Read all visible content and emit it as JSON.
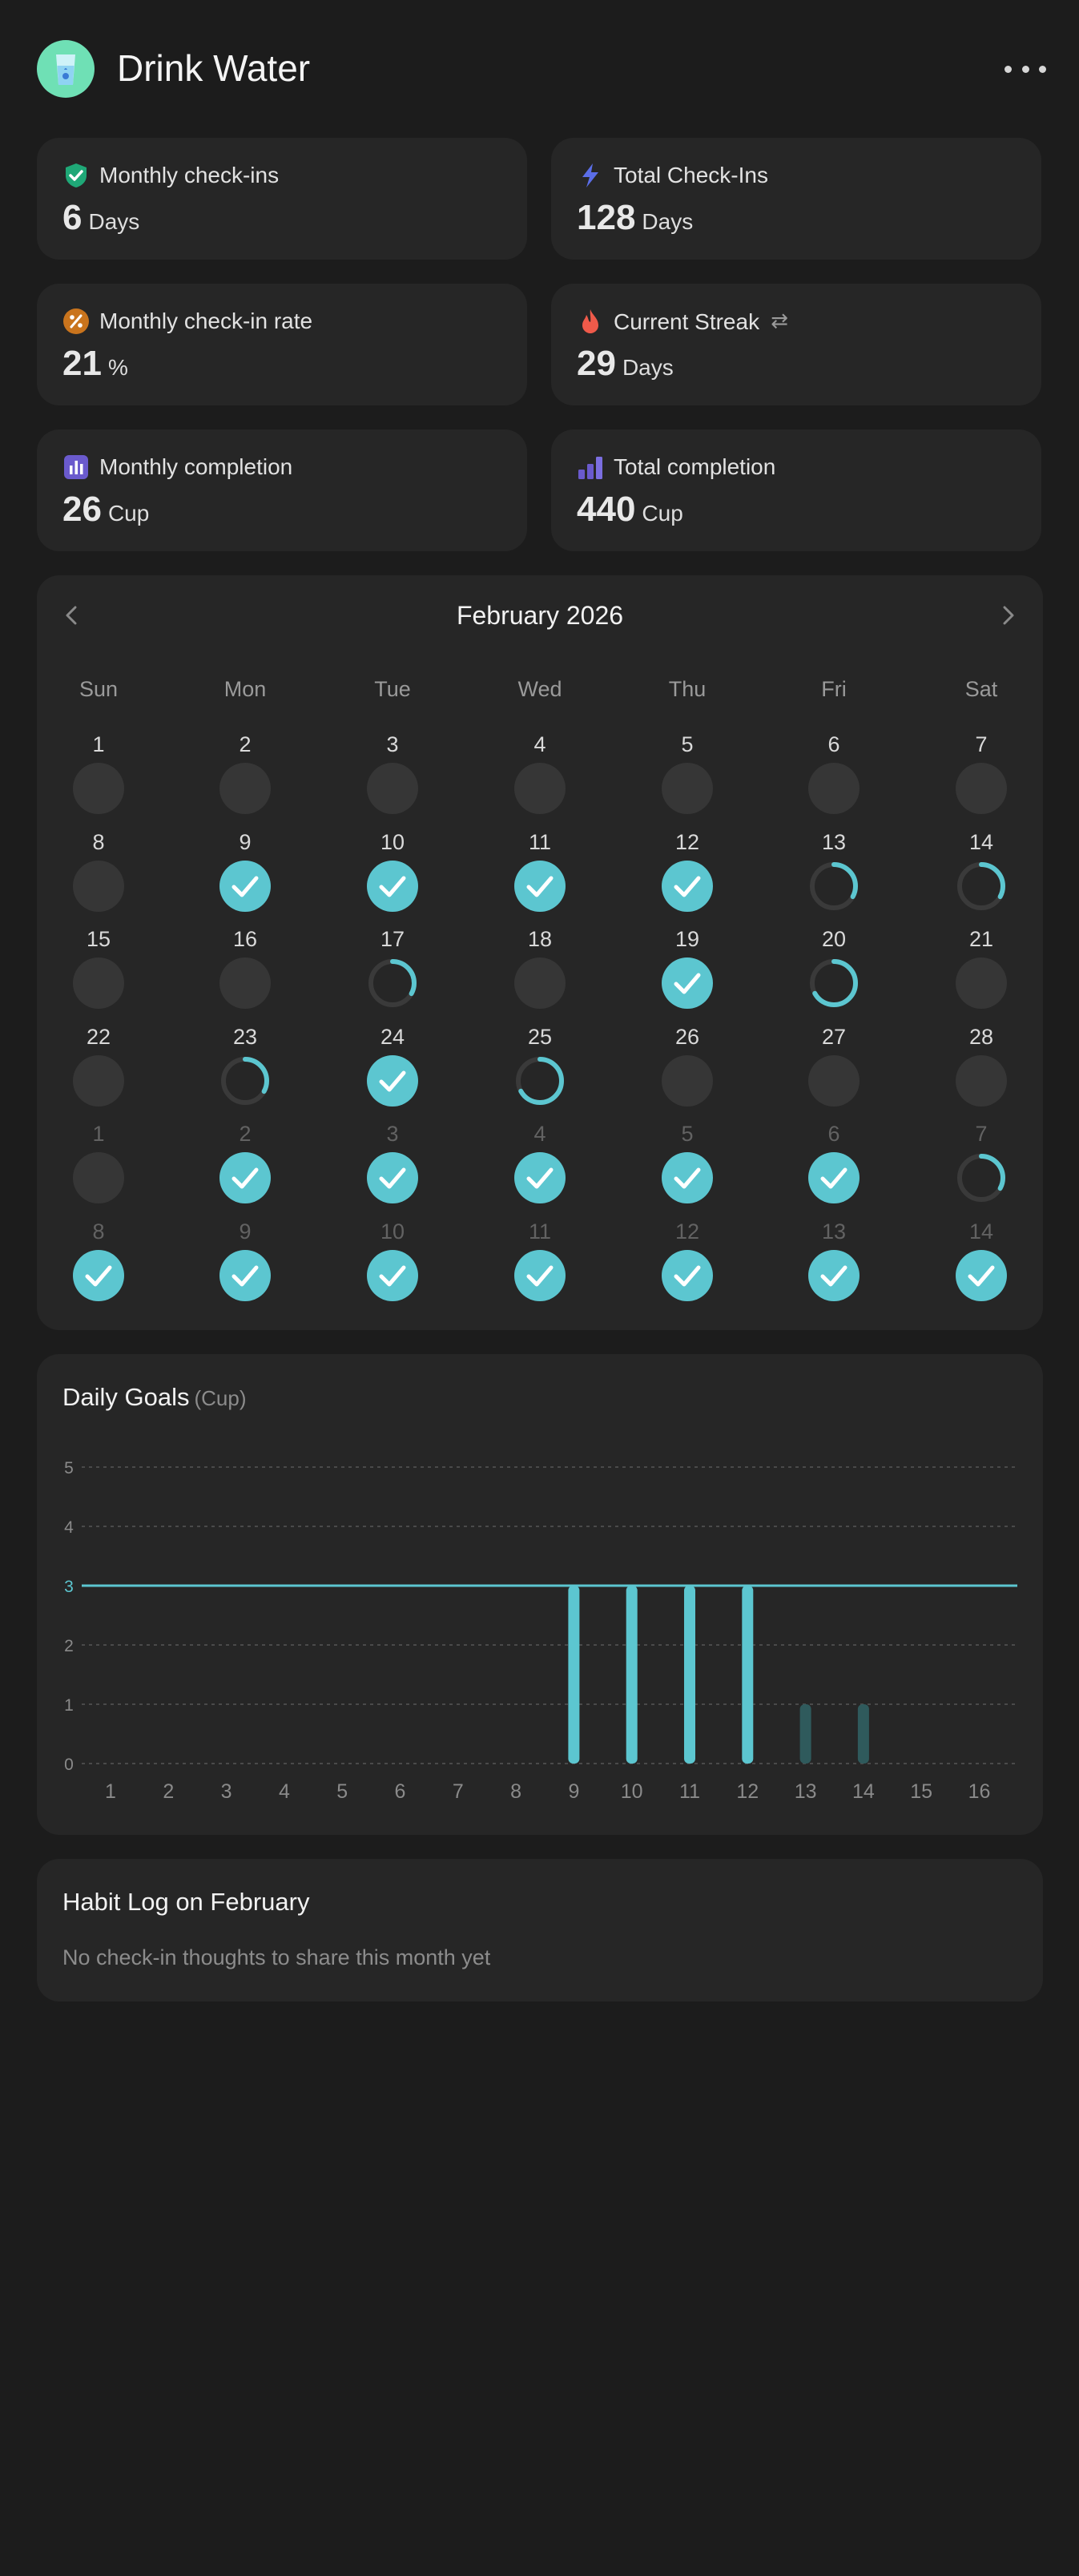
{
  "app": {
    "title": "Drink Water"
  },
  "stats": [
    {
      "label": "Monthly check-ins",
      "value": "6",
      "unit": "Days",
      "icon": "check-shield-icon",
      "color": "#1fa877"
    },
    {
      "label": "Total Check-Ins",
      "value": "128",
      "unit": "Days",
      "icon": "lightning-icon",
      "color": "#5b6ee8"
    },
    {
      "label": "Monthly check-in rate",
      "value": "21",
      "unit": "%",
      "icon": "percent-icon",
      "color": "#c9741d"
    },
    {
      "label": "Current Streak",
      "value": "29",
      "unit": "Days",
      "icon": "flame-icon",
      "color": "#ef5a4a"
    },
    {
      "label": "Monthly completion",
      "value": "26",
      "unit": "Cup",
      "icon": "bar-chart-icon",
      "color": "#6a5acd"
    },
    {
      "label": "Total completion",
      "value": "440",
      "unit": "Cup",
      "icon": "stacked-bars-icon",
      "color": "#6a5acd"
    }
  ],
  "calendar": {
    "title": "February 2026",
    "weekdays": [
      "Sun",
      "Mon",
      "Tue",
      "Wed",
      "Thu",
      "Fri",
      "Sat"
    ],
    "accent": "#5cc6d0",
    "weeks": [
      [
        {
          "d": "1",
          "p": 0
        },
        {
          "d": "2",
          "p": 0
        },
        {
          "d": "3",
          "p": 0
        },
        {
          "d": "4",
          "p": 0
        },
        {
          "d": "5",
          "p": 0
        },
        {
          "d": "6",
          "p": 0
        },
        {
          "d": "7",
          "p": 0
        }
      ],
      [
        {
          "d": "8",
          "p": 0
        },
        {
          "d": "9",
          "p": 1
        },
        {
          "d": "10",
          "p": 1
        },
        {
          "d": "11",
          "p": 1
        },
        {
          "d": "12",
          "p": 1
        },
        {
          "d": "13",
          "p": 0.33
        },
        {
          "d": "14",
          "p": 0.33
        }
      ],
      [
        {
          "d": "15",
          "p": 0
        },
        {
          "d": "16",
          "p": 0
        },
        {
          "d": "17",
          "p": 0.33
        },
        {
          "d": "18",
          "p": 0
        },
        {
          "d": "19",
          "p": 1
        },
        {
          "d": "20",
          "p": 0.67
        },
        {
          "d": "21",
          "p": 0
        }
      ],
      [
        {
          "d": "22",
          "p": 0
        },
        {
          "d": "23",
          "p": 0.33
        },
        {
          "d": "24",
          "p": 1
        },
        {
          "d": "25",
          "p": 0.67
        },
        {
          "d": "26",
          "p": 0
        },
        {
          "d": "27",
          "p": 0
        },
        {
          "d": "28",
          "p": 0
        }
      ],
      [
        {
          "d": "1",
          "p": 0,
          "other": true
        },
        {
          "d": "2",
          "p": 1,
          "other": true
        },
        {
          "d": "3",
          "p": 1,
          "other": true
        },
        {
          "d": "4",
          "p": 1,
          "other": true
        },
        {
          "d": "5",
          "p": 1,
          "other": true
        },
        {
          "d": "6",
          "p": 1,
          "other": true
        },
        {
          "d": "7",
          "p": 0.33,
          "other": true
        }
      ],
      [
        {
          "d": "8",
          "p": 1,
          "other": true
        },
        {
          "d": "9",
          "p": 1,
          "other": true
        },
        {
          "d": "10",
          "p": 1,
          "other": true
        },
        {
          "d": "11",
          "p": 1,
          "other": true
        },
        {
          "d": "12",
          "p": 1,
          "other": true
        },
        {
          "d": "13",
          "p": 1,
          "other": true
        },
        {
          "d": "14",
          "p": 1,
          "other": true
        }
      ]
    ]
  },
  "daily_goals": {
    "title": "Daily Goals",
    "unit": "(Cup)",
    "chart_data": {
      "type": "bar",
      "categories": [
        "1",
        "2",
        "3",
        "4",
        "5",
        "6",
        "7",
        "8",
        "9",
        "10",
        "11",
        "12",
        "13",
        "14",
        "15",
        "16"
      ],
      "values": [
        0,
        0,
        0,
        0,
        0,
        0,
        0,
        0,
        3,
        3,
        3,
        3,
        1,
        1,
        0,
        0
      ],
      "goal": 3,
      "ylim": [
        0,
        5
      ],
      "yticks": [
        "0",
        "1",
        "2",
        "3",
        "4",
        "5"
      ],
      "grid": true,
      "bar_color": "#5cc6d0",
      "incomplete_color": "#2f5a5c"
    }
  },
  "habit_log": {
    "title": "Habit Log on February",
    "empty_text": "No check-in thoughts to share this month yet"
  }
}
